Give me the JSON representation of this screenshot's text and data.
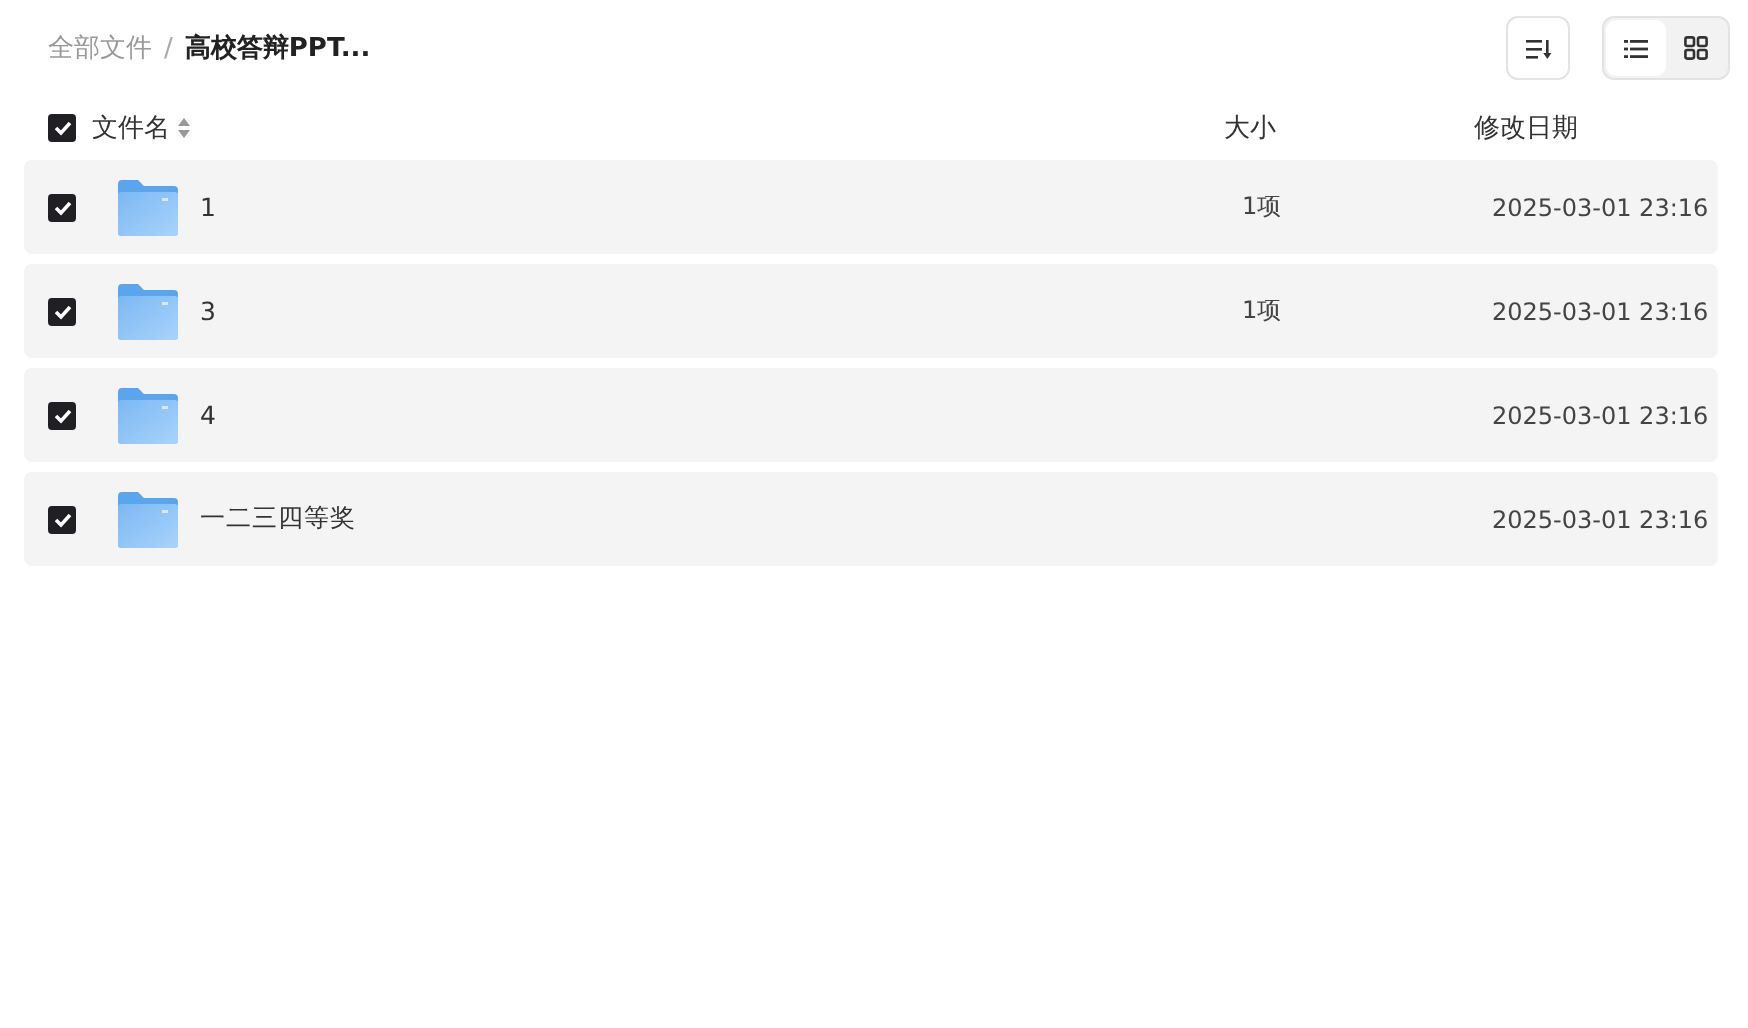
{
  "breadcrumb": [
    {
      "kind": "link",
      "label": "全部文件",
      "current": false
    },
    {
      "kind": "separator",
      "label": "/"
    },
    {
      "kind": "link",
      "label": "高校答辩PPT...",
      "current": true
    }
  ],
  "toolbar": {
    "view_modes": [
      {
        "kind": "list",
        "selected": true
      },
      {
        "kind": "grid",
        "selected": false
      }
    ]
  },
  "table": {
    "select_all": {
      "checked": true
    },
    "columns": [
      {
        "label": "文件名",
        "sortable": true
      },
      {
        "label": "大小",
        "sortable": false
      },
      {
        "label": "修改日期",
        "sortable": false
      }
    ],
    "rows": [
      {
        "checked": true,
        "name": "1",
        "size": "1项",
        "modified": "2025-03-01 23:16"
      },
      {
        "checked": true,
        "name": "3",
        "size": "1项",
        "modified": "2025-03-01 23:16"
      },
      {
        "checked": true,
        "name": "4",
        "modified": "2025-03-01 23:16"
      },
      {
        "checked": true,
        "name": "一二三四等奖",
        "modified": "2025-03-01 23:16"
      }
    ]
  }
}
